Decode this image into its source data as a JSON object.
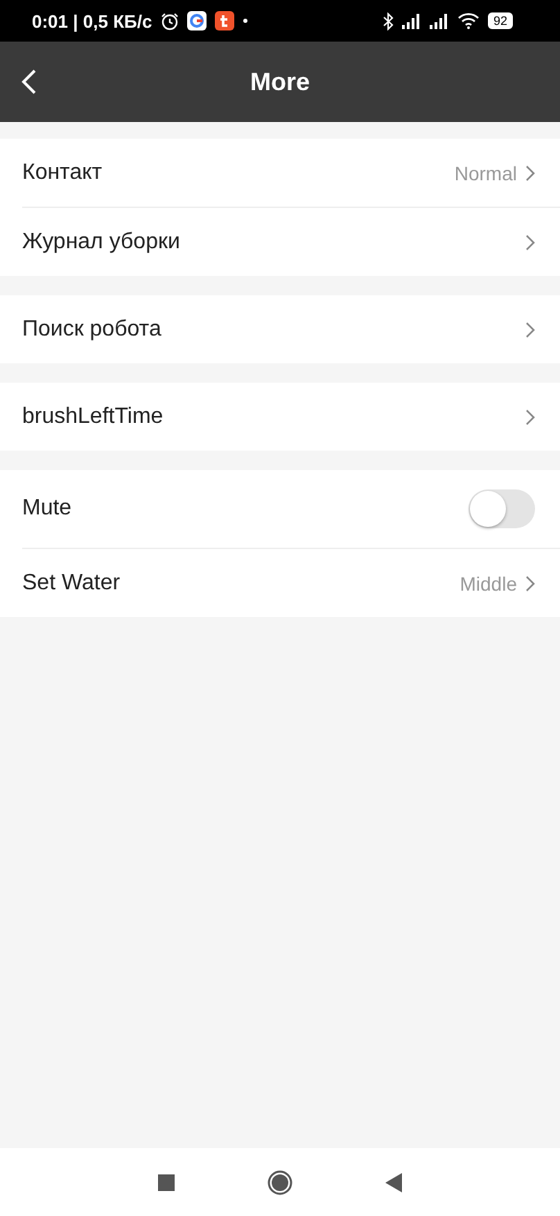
{
  "status_bar": {
    "time": "0:01 | 0,5 КБ/с",
    "battery": "92"
  },
  "header": {
    "title": "More"
  },
  "groups": [
    {
      "items": [
        {
          "kind": "link",
          "label": "Контакт",
          "value": "Normal"
        },
        {
          "kind": "link",
          "label": "Журнал уборки"
        }
      ]
    },
    {
      "items": [
        {
          "kind": "link",
          "label": "Поиск робота"
        }
      ]
    },
    {
      "items": [
        {
          "kind": "link",
          "label": "brushLeftTime"
        }
      ]
    },
    {
      "items": [
        {
          "kind": "toggle",
          "label": "Mute",
          "on": false
        },
        {
          "kind": "link",
          "label": "Set Water",
          "value": "Middle"
        }
      ]
    }
  ]
}
